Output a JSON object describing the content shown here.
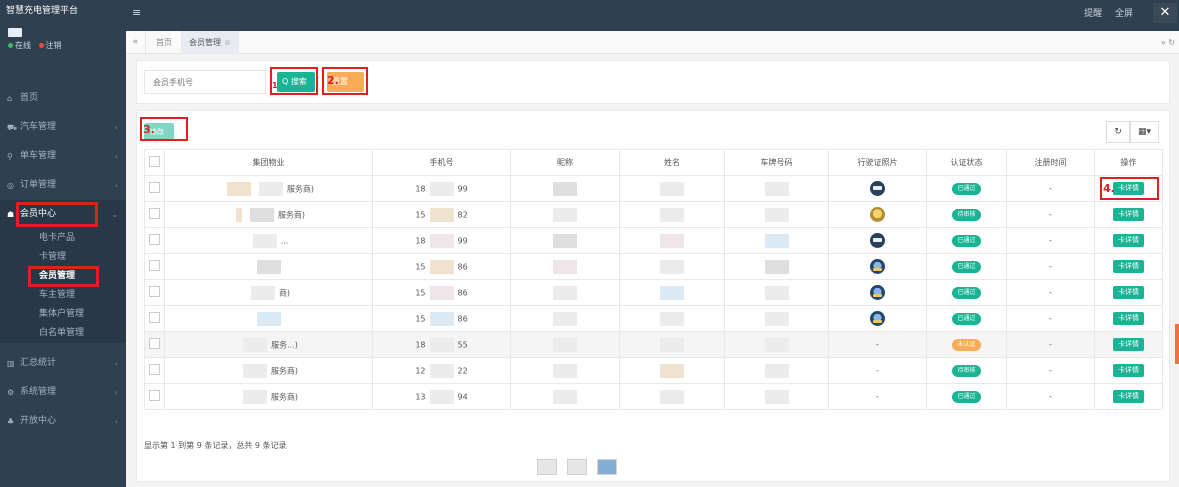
{
  "brand": "智慧充电管理平台",
  "user": {
    "online": "在线",
    "logout": "注销"
  },
  "nav": {
    "home": "首页",
    "car": "汽车管理",
    "bike": "单车管理",
    "orders": "订单管理",
    "member": "会员中心",
    "member_sub": [
      "电卡产品",
      "卡管理",
      "会员管理",
      "车主管理",
      "集体户管理",
      "白名单管理"
    ],
    "stats": "汇总统计",
    "system": "系统管理",
    "open": "开放中心"
  },
  "topbar": {
    "item1": "提醒",
    "item2": "全屏"
  },
  "tabs": {
    "home": "首页",
    "member": "会员管理"
  },
  "search": {
    "placeholder": "会员手机号",
    "search_label": "Q 搜索",
    "reset_label": "重置"
  },
  "annotations": {
    "n1": "1",
    "n2": "2.",
    "n3": "3.",
    "n4": "4."
  },
  "toolbar": {
    "edit_label": "修改",
    "refresh": "↻",
    "columns": "▦▾"
  },
  "table": {
    "headers": [
      "集团物业",
      "手机号",
      "昵称",
      "姓名",
      "车牌号码",
      "行驶证照片",
      "认证状态",
      "注册时间",
      "操作"
    ],
    "rows": [
      {
        "group": "服务商)",
        "phone_pre": "18",
        "phone_suf": "99",
        "status": "已通过",
        "time": "-",
        "op": "卡详情"
      },
      {
        "group": "服务商)",
        "phone_pre": "15",
        "phone_suf": "82",
        "status": "待审核",
        "time": "-",
        "op": "卡详情"
      },
      {
        "group": "...",
        "phone_pre": "18",
        "phone_suf": "99",
        "status": "已通过",
        "time": "-",
        "op": "卡详情"
      },
      {
        "group": "",
        "phone_pre": "15",
        "phone_suf": "86",
        "status": "已通过",
        "time": "-",
        "op": "卡详情"
      },
      {
        "group": "商)",
        "phone_pre": "15",
        "phone_suf": "86",
        "status": "已通过",
        "time": "-",
        "op": "卡详情"
      },
      {
        "group": "",
        "phone_pre": "15",
        "phone_suf": "86",
        "status": "已通过",
        "time": "-",
        "op": "卡详情"
      },
      {
        "group": "服务...)",
        "phone_pre": "18",
        "phone_suf": "55",
        "license": "-",
        "status": "未认证",
        "time": "-",
        "op": "卡详情"
      },
      {
        "group": "服务商)",
        "phone_pre": "12",
        "phone_suf": "22",
        "license": "-",
        "status": "待审核",
        "time": "-",
        "op": "卡详情"
      },
      {
        "group": "服务商)",
        "phone_pre": "13",
        "phone_suf": "94",
        "license": "-",
        "status": "已通过",
        "time": "-",
        "op": "卡详情"
      }
    ]
  },
  "footer": "显示第 1 到第 9 条记录，总共 9 条记录"
}
